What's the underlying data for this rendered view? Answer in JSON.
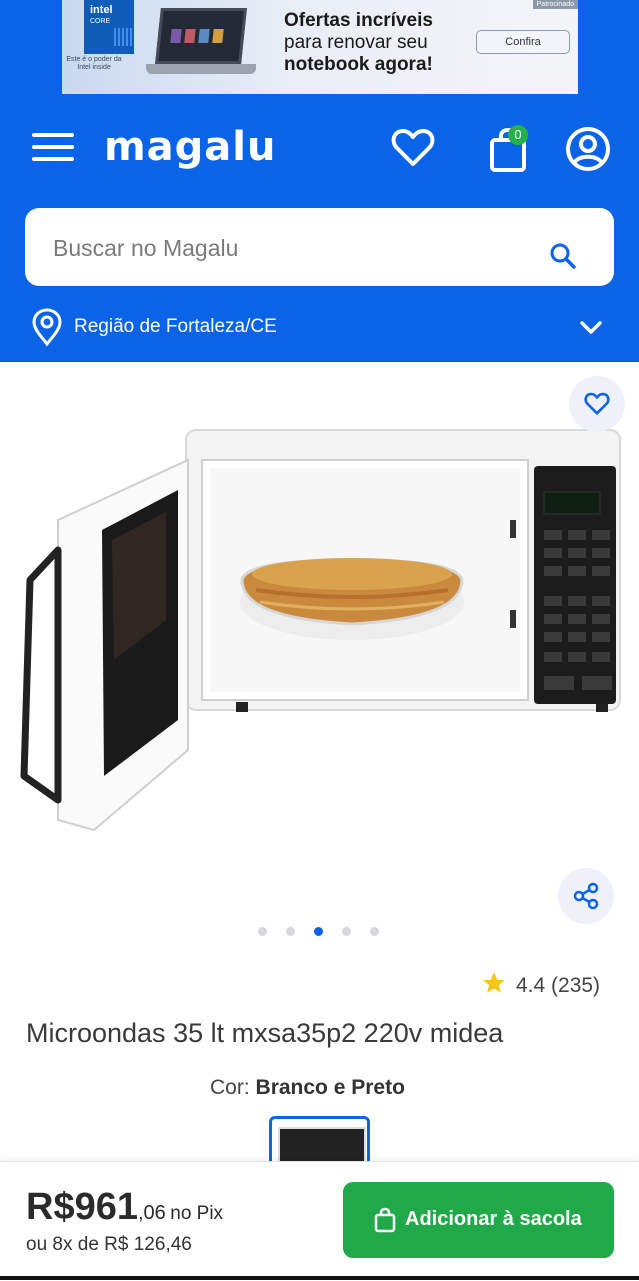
{
  "ad": {
    "brand": "intel",
    "brand_sub": "CORE",
    "small_print": "Este é o poder da Intel inside",
    "headline_1": "Ofertas incríveis",
    "headline_2": "para renovar seu",
    "headline_3": "notebook agora!",
    "cta": "Confira",
    "tag": "Patrocinado"
  },
  "header": {
    "logo": "magalu",
    "cart_count": "0",
    "colors": {
      "primary": "#0b64e8",
      "accent": "#21a849"
    }
  },
  "search": {
    "placeholder": "Buscar no Magalu"
  },
  "location": {
    "label": "Região de Fortaleza/CE"
  },
  "carousel": {
    "total": 5,
    "active_index": 2
  },
  "product": {
    "rating": "4.4 (235)",
    "rating_value": 4.4,
    "title": "Microondas 35 lt mxsa35p2 220v midea",
    "color_label": "Cor:",
    "color_value": "Branco e Preto"
  },
  "footer": {
    "price_main": "R$961",
    "price_cents": ",06",
    "price_method": "no Pix",
    "installments": "ou 8x de R$ 126,46",
    "add_button": "Adicionar à sacola"
  },
  "icons": [
    "menu-icon",
    "heart-icon",
    "bag-icon",
    "user-icon",
    "search-icon",
    "location-pin-icon",
    "chevron-down-icon",
    "share-icon",
    "star-icon"
  ]
}
